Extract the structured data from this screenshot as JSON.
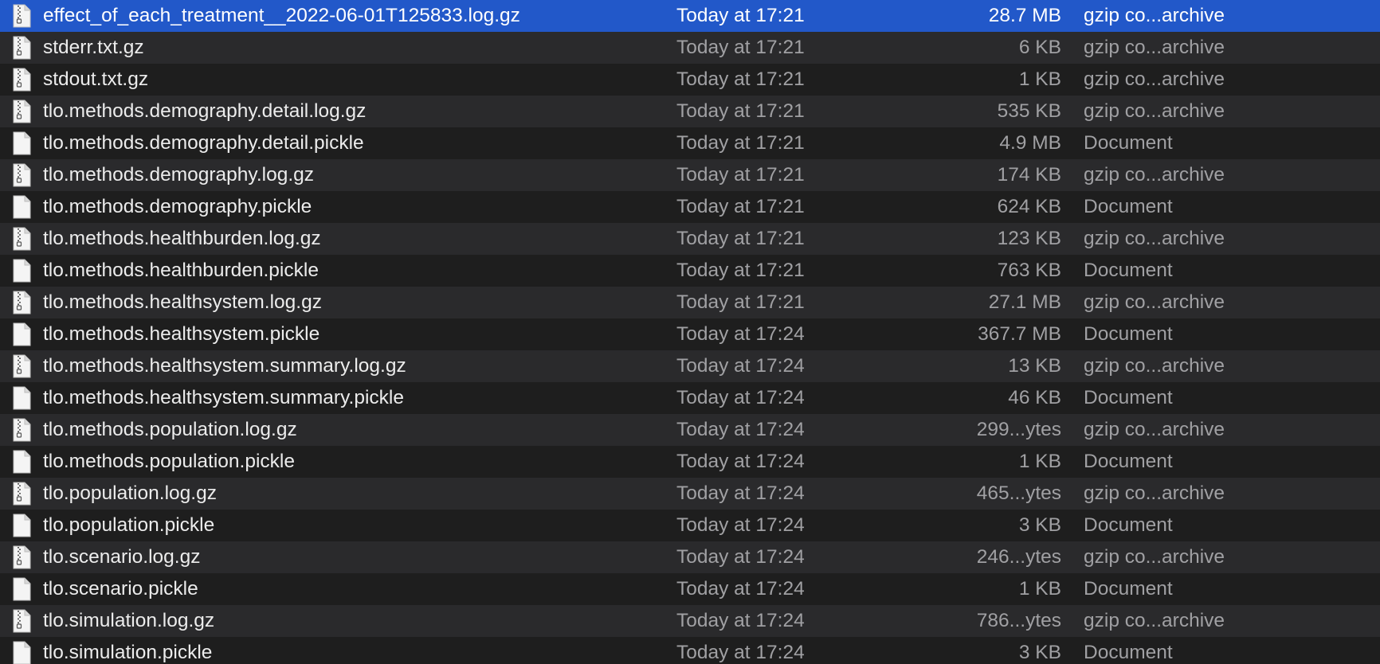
{
  "colors": {
    "background": "#1e1e1e",
    "alternate_row": "#2a2a2c",
    "selection": "#2258c9",
    "name_text": "#ececec",
    "secondary_text": "#a0a0a3"
  },
  "files": [
    {
      "name": "effect_of_each_treatment__2022-06-01T125833.log.gz",
      "date": "Today at 17:21",
      "size": "28.7 MB",
      "kind": "gzip co...archive",
      "icon": "zip-archive-icon",
      "selected": true
    },
    {
      "name": "stderr.txt.gz",
      "date": "Today at 17:21",
      "size": "6 KB",
      "kind": "gzip co...archive",
      "icon": "zip-archive-icon",
      "selected": false
    },
    {
      "name": "stdout.txt.gz",
      "date": "Today at 17:21",
      "size": "1 KB",
      "kind": "gzip co...archive",
      "icon": "zip-archive-icon",
      "selected": false
    },
    {
      "name": "tlo.methods.demography.detail.log.gz",
      "date": "Today at 17:21",
      "size": "535 KB",
      "kind": "gzip co...archive",
      "icon": "zip-archive-icon",
      "selected": false
    },
    {
      "name": "tlo.methods.demography.detail.pickle",
      "date": "Today at 17:21",
      "size": "4.9 MB",
      "kind": "Document",
      "icon": "document-icon",
      "selected": false
    },
    {
      "name": "tlo.methods.demography.log.gz",
      "date": "Today at 17:21",
      "size": "174 KB",
      "kind": "gzip co...archive",
      "icon": "zip-archive-icon",
      "selected": false
    },
    {
      "name": "tlo.methods.demography.pickle",
      "date": "Today at 17:21",
      "size": "624 KB",
      "kind": "Document",
      "icon": "document-icon",
      "selected": false
    },
    {
      "name": "tlo.methods.healthburden.log.gz",
      "date": "Today at 17:21",
      "size": "123 KB",
      "kind": "gzip co...archive",
      "icon": "zip-archive-icon",
      "selected": false
    },
    {
      "name": "tlo.methods.healthburden.pickle",
      "date": "Today at 17:21",
      "size": "763 KB",
      "kind": "Document",
      "icon": "document-icon",
      "selected": false
    },
    {
      "name": "tlo.methods.healthsystem.log.gz",
      "date": "Today at 17:21",
      "size": "27.1 MB",
      "kind": "gzip co...archive",
      "icon": "zip-archive-icon",
      "selected": false
    },
    {
      "name": "tlo.methods.healthsystem.pickle",
      "date": "Today at 17:24",
      "size": "367.7 MB",
      "kind": "Document",
      "icon": "document-icon",
      "selected": false
    },
    {
      "name": "tlo.methods.healthsystem.summary.log.gz",
      "date": "Today at 17:24",
      "size": "13 KB",
      "kind": "gzip co...archive",
      "icon": "zip-archive-icon",
      "selected": false
    },
    {
      "name": "tlo.methods.healthsystem.summary.pickle",
      "date": "Today at 17:24",
      "size": "46 KB",
      "kind": "Document",
      "icon": "document-icon",
      "selected": false
    },
    {
      "name": "tlo.methods.population.log.gz",
      "date": "Today at 17:24",
      "size": "299...ytes",
      "kind": "gzip co...archive",
      "icon": "zip-archive-icon",
      "selected": false
    },
    {
      "name": "tlo.methods.population.pickle",
      "date": "Today at 17:24",
      "size": "1 KB",
      "kind": "Document",
      "icon": "document-icon",
      "selected": false
    },
    {
      "name": "tlo.population.log.gz",
      "date": "Today at 17:24",
      "size": "465...ytes",
      "kind": "gzip co...archive",
      "icon": "zip-archive-icon",
      "selected": false
    },
    {
      "name": "tlo.population.pickle",
      "date": "Today at 17:24",
      "size": "3 KB",
      "kind": "Document",
      "icon": "document-icon",
      "selected": false
    },
    {
      "name": "tlo.scenario.log.gz",
      "date": "Today at 17:24",
      "size": "246...ytes",
      "kind": "gzip co...archive",
      "icon": "zip-archive-icon",
      "selected": false
    },
    {
      "name": "tlo.scenario.pickle",
      "date": "Today at 17:24",
      "size": "1 KB",
      "kind": "Document",
      "icon": "document-icon",
      "selected": false
    },
    {
      "name": "tlo.simulation.log.gz",
      "date": "Today at 17:24",
      "size": "786...ytes",
      "kind": "gzip co...archive",
      "icon": "zip-archive-icon",
      "selected": false
    },
    {
      "name": "tlo.simulation.pickle",
      "date": "Today at 17:24",
      "size": "3 KB",
      "kind": "Document",
      "icon": "document-icon",
      "selected": false
    }
  ]
}
